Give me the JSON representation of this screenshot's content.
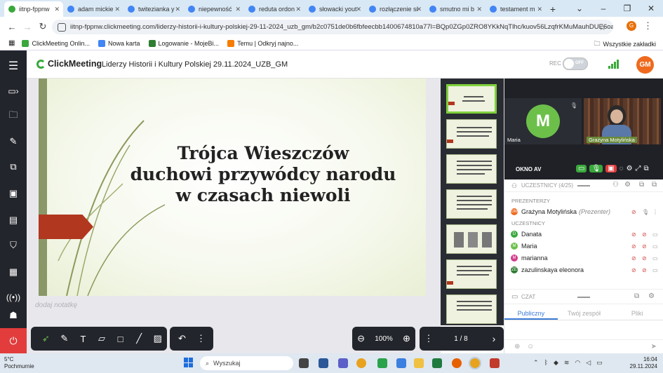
{
  "browser": {
    "tabs": [
      {
        "title": "iitnp-fppnw",
        "active": true,
        "color": "#3aa83c"
      },
      {
        "title": "adam mickie",
        "color": "#4285f4"
      },
      {
        "title": "twitezianka y",
        "color": "#4285f4"
      },
      {
        "title": "niepewność",
        "color": "#4285f4"
      },
      {
        "title": "reduta ordon",
        "color": "#4285f4"
      },
      {
        "title": "słowacki yout",
        "color": "#4285f4"
      },
      {
        "title": "rozłączenie si",
        "color": "#4285f4"
      },
      {
        "title": "smutno mi b",
        "color": "#4285f4"
      },
      {
        "title": "testament m",
        "color": "#4285f4"
      }
    ],
    "url": "iitnp-fppnw.clickmeeting.com/liderzy-historii-i-kultury-polskiej-29-11-2024_uzb_gm/b2c0751de0b6fbfeecbb1400674810a77l=BQp0ZGp0ZRO8YKkNqTlhc/kuov56LzqfrKMuMauhDUE6oaM5YaOvr...",
    "profile_initial": "G",
    "bookmarks": [
      {
        "label": "ClickMeeting Onlin...",
        "color": "#3aa83c"
      },
      {
        "label": "Nowa karta",
        "color": "#4285f4"
      },
      {
        "label": "Logowanie - MojeBi...",
        "color": "#2e7d32"
      },
      {
        "label": "Temu | Odkryj najno...",
        "color": "#f57c00"
      }
    ],
    "all_bookmarks": "Wszystkie zakładki"
  },
  "header": {
    "logo": "ClickMeeting",
    "room_name": "Liderzy Historii i Kultury Polskiej 29.11.2024_UZB_GM",
    "rec_label": "REC",
    "rec_toggle": "OFF",
    "user_initials": "GM"
  },
  "slide": {
    "title_lines": [
      "Trójca Wieszczów",
      "duchowi przywódcy narodu",
      "w czasach niewoli"
    ],
    "note_placeholder": "dodaj notatkę"
  },
  "zoom": {
    "value": "100%"
  },
  "pages": {
    "current_total": "1 / 8"
  },
  "participants": {
    "av_header": "OKNO AV",
    "count_label": "UCZESTNICY (4/25)",
    "presenters_label": "PREZENTERZY",
    "attendees_label": "UCZESTNICY",
    "presenter": {
      "name": "Grażyna Motylińska",
      "role": "(Prezenter)",
      "color": "#ef6a1e",
      "initial": "GM"
    },
    "attendees": [
      {
        "name": "Danata",
        "initial": "D",
        "color": "#3aa83c"
      },
      {
        "name": "Maria",
        "initial": "M",
        "color": "#6cc04a"
      },
      {
        "name": "marianna",
        "initial": "M",
        "color": "#d23c8c"
      },
      {
        "name": "zazulinskaya eleonora",
        "initial": "ZE",
        "color": "#2e7d32"
      }
    ]
  },
  "videos": {
    "tile1_name": "Maria",
    "tile1_initial": "M",
    "tile2_name": "Grażyna Motylińska"
  },
  "chat": {
    "header": "CZAT",
    "tabs": [
      "Publiczny",
      "Twój zespół",
      "Pliki"
    ]
  },
  "taskbar": {
    "temp": "5°C",
    "weather": "Pochmurnie",
    "search": "Wyszukaj",
    "time": "16:04",
    "date": "29.11.2024"
  }
}
